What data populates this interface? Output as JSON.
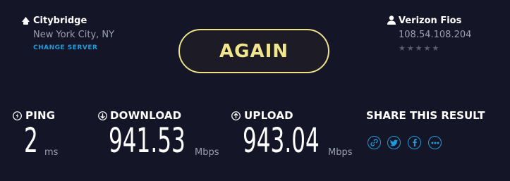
{
  "server": {
    "name": "Citybridge",
    "location": "New York City, NY",
    "change_label": "CHANGE SERVER",
    "icon": "server-marker-icon"
  },
  "isp": {
    "name": "Verizon Fios",
    "ip": "108.54.108.204",
    "rating_stars": "★★★★★",
    "rating_value": 0,
    "rating_max": 5,
    "icon": "user-icon"
  },
  "action": {
    "again_label": "AGAIN"
  },
  "metrics": {
    "ping": {
      "label": "PING",
      "value": "2",
      "unit": "ms"
    },
    "download": {
      "label": "DOWNLOAD",
      "value": "941.53",
      "unit": "Mbps"
    },
    "upload": {
      "label": "UPLOAD",
      "value": "943.04",
      "unit": "Mbps"
    }
  },
  "share": {
    "title": "SHARE THIS RESULT",
    "buttons": [
      "link-icon",
      "twitter-icon",
      "facebook-icon",
      "more-icon"
    ]
  },
  "colors": {
    "background": "#141526",
    "accent_yellow": "#f1e68c",
    "accent_blue": "#1f9bdc",
    "muted_text": "#9a9fb0"
  }
}
